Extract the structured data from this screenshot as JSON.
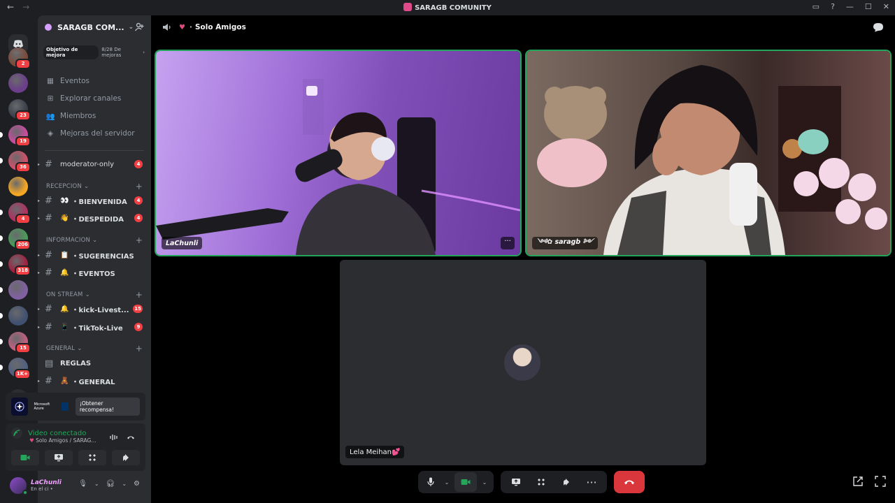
{
  "window": {
    "title": "SARAGB COMUNITY",
    "back": "←",
    "forward": "→"
  },
  "guilds": [
    {
      "color": "#7a4a3a",
      "badge": "2",
      "pip": false
    },
    {
      "color": "#6b3d8a",
      "badge": "",
      "pip": false
    },
    {
      "color": "#3a3f4a",
      "badge": "23",
      "pip": false
    },
    {
      "color": "#c94ca0",
      "badge": "19",
      "pip": true
    },
    {
      "color": "#d0506a",
      "badge": "36",
      "pip": true
    },
    {
      "color": "#f5a623",
      "badge": "",
      "pip": false
    },
    {
      "color": "#b03060",
      "badge": "4",
      "pip": true
    },
    {
      "color": "#4a9a5a",
      "badge": "206",
      "pip": true
    },
    {
      "color": "#a02040",
      "badge": "318",
      "pip": true
    },
    {
      "color": "#8060a0",
      "badge": "",
      "pip": true
    },
    {
      "color": "#405070",
      "badge": "",
      "pip": true
    },
    {
      "color": "#c06080",
      "badge": "15",
      "pip": true
    },
    {
      "color": "#506080",
      "badge": "1K+",
      "pip": true
    }
  ],
  "server": {
    "name": "SARAGB COM...",
    "boost_goal": "Objetivo de mejora",
    "boost_progress": "8/28 De mejoras"
  },
  "menu": [
    {
      "label": "Eventos",
      "icon": "calendar-icon"
    },
    {
      "label": "Explorar canales",
      "icon": "browse-icon"
    },
    {
      "label": "Miembros",
      "icon": "members-icon"
    },
    {
      "label": "Mejoras del servidor",
      "icon": "boost-icon"
    }
  ],
  "channels": {
    "moderator": {
      "name": "moderator-only",
      "badge": "4"
    },
    "recepcion": {
      "label": "RECEPCION",
      "items": [
        {
          "emoji": "👀",
          "name": "・BIENVENIDA",
          "badge": "4"
        },
        {
          "emoji": "👋",
          "name": "・DESPEDIDA",
          "badge": "4"
        }
      ]
    },
    "informacion": {
      "label": "INFORMACION",
      "items": [
        {
          "emoji": "📋",
          "name": "・SUGERENCIAS",
          "badge": ""
        },
        {
          "emoji": "🔔",
          "name": "・EVENTOS",
          "badge": ""
        }
      ]
    },
    "onstream": {
      "label": "ON STREAM",
      "items": [
        {
          "emoji": "🔔",
          "name": "・kick-Livest...",
          "badge": "15"
        },
        {
          "emoji": "📱",
          "name": "・TikTok-Live",
          "badge": "9"
        }
      ]
    },
    "general": {
      "label": "GENERAL",
      "items": [
        {
          "emoji": "",
          "name": "REGLAS",
          "badge": ""
        },
        {
          "emoji": "🧸",
          "name": "・GENERAL",
          "badge": ""
        }
      ]
    }
  },
  "promo": {
    "brand": "Microsoft Azure",
    "cta": "¡Obtener recompensa!"
  },
  "voice": {
    "status": "Video conectado",
    "location": "Solo Amigos / SARAG..."
  },
  "user": {
    "name": "LaChunli",
    "status": "En el ci •"
  },
  "call": {
    "channel": "Solo Amigos",
    "participants": [
      {
        "name": "LaChunli",
        "speaking": true
      },
      {
        "name": "༺✿ saragb ༻",
        "speaking": true
      },
      {
        "name": "Lela Meihan💕",
        "speaking": false
      }
    ],
    "more": "···"
  }
}
